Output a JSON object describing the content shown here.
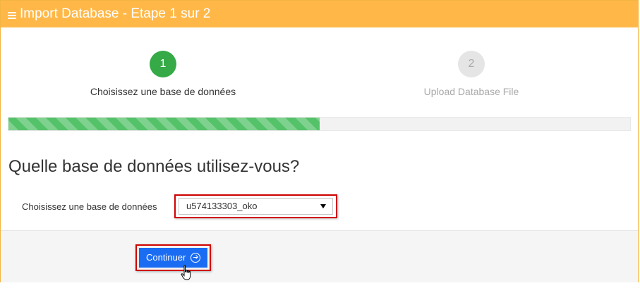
{
  "header": {
    "title": "Import Database - Etape 1 sur 2",
    "icon": "menu-icon",
    "color": "#ffb848"
  },
  "steps": [
    {
      "number": "1",
      "label": "Choisissez une base de données",
      "state": "active",
      "color": "#35aa47"
    },
    {
      "number": "2",
      "label": "Upload Database File",
      "state": "inactive"
    }
  ],
  "progress": {
    "fraction": 0.5,
    "color": "#54c269"
  },
  "main": {
    "question": "Quelle base de données utilisez-vous?",
    "field_label": "Choisissez une base de données",
    "select_value": "u574133303_oko"
  },
  "footer": {
    "button_label": "Continuer",
    "button_icon": "arrow-circle-right-icon",
    "button_color": "#1a6cf3",
    "highlight_color": "#d00000"
  }
}
